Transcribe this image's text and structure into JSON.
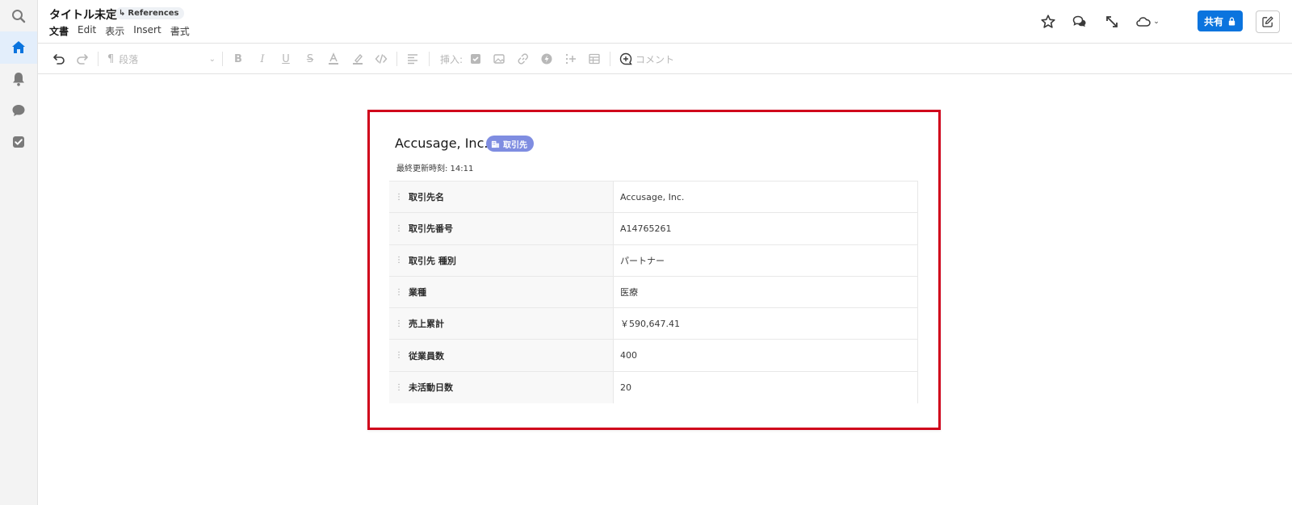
{
  "header": {
    "title": "タイトル未定",
    "references_chip": "References",
    "menu": [
      "文書",
      "Edit",
      "表示",
      "Insert",
      "書式"
    ],
    "share_label": "共有"
  },
  "toolbar": {
    "paragraph_style": "段落",
    "insert_label": "挿入:",
    "comment_label": "コメント"
  },
  "record": {
    "name": "Accusage, Inc.",
    "object_badge": "取引先",
    "last_updated": "最終更新時刻: 14:11",
    "fields": [
      {
        "label": "取引先名",
        "value": "Accusage, Inc."
      },
      {
        "label": "取引先番号",
        "value": "A14765261"
      },
      {
        "label": "取引先 種別",
        "value": "パートナー"
      },
      {
        "label": "業種",
        "value": "医療"
      },
      {
        "label": "売上累計",
        "value": "￥590,647.41"
      },
      {
        "label": "従業員数",
        "value": "400"
      },
      {
        "label": "未活動日数",
        "value": "20"
      }
    ]
  },
  "colors": {
    "accent": "#0b74de",
    "badge": "#7f8de1",
    "highlight_border": "#d0021b"
  },
  "icons": {
    "rail": [
      "search-icon",
      "home-icon",
      "bell-icon",
      "chat-icon",
      "task-icon"
    ],
    "header": [
      "star-icon",
      "chat-bubbles-icon",
      "expand-icon",
      "cloud-icon",
      "lock-icon",
      "edit-icon"
    ]
  }
}
